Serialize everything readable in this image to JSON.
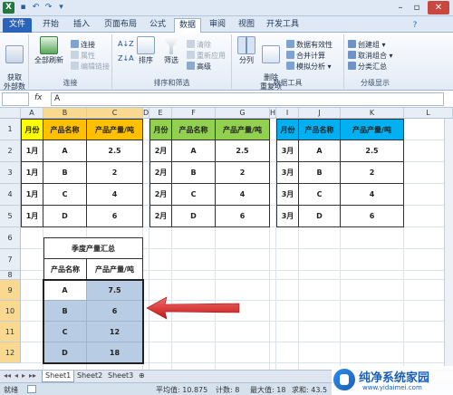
{
  "titlebar": {
    "app_icon": "X",
    "qa_icons": [
      "save-icon",
      "undo-icon",
      "redo-icon",
      "customize-icon"
    ]
  },
  "tabs": [
    "文件",
    "开始",
    "插入",
    "页面布局",
    "公式",
    "数据",
    "审阅",
    "视图",
    "开发工具"
  ],
  "active_tab": "数据",
  "ribbon": {
    "get_external": "获取\n外部数据",
    "refresh_all": "全部刷新",
    "connections": "连接",
    "properties": "属性",
    "edit_links": "编辑链接",
    "group_connect": "连接",
    "sort_az": "A↓Z",
    "sort_za": "Z↓A",
    "sort": "排序",
    "filter": "筛选",
    "clear": "清除",
    "reapply": "重新应用",
    "advanced": "高级",
    "group_sortfilter": "排序和筛选",
    "split": "分列",
    "remove_dup": "删除\n重复项",
    "data_valid": "数据有效性",
    "consolidate": "合并计算",
    "whatif": "模拟分析",
    "group_tools": "数据工具",
    "group_create": "创建组",
    "ungroup": "取消组合",
    "subtotal": "分类汇总",
    "group_outline": "分级显示"
  },
  "formula_bar": {
    "fx": "fx",
    "value": "A"
  },
  "columns": [
    "A",
    "B",
    "C",
    "D",
    "E",
    "F",
    "G",
    "H",
    "I",
    "J",
    "K",
    "L"
  ],
  "rows": [
    "1",
    "2",
    "3",
    "4",
    "5",
    "6",
    "7",
    "8",
    "9",
    "10",
    "11",
    "12"
  ],
  "tables": [
    {
      "month_header": "月份",
      "name_header": "产品名称",
      "prod_header": "产品产量/吨",
      "rows": [
        [
          "1月",
          "A",
          "2.5"
        ],
        [
          "1月",
          "B",
          "2"
        ],
        [
          "1月",
          "C",
          "4"
        ],
        [
          "1月",
          "D",
          "6"
        ]
      ]
    },
    {
      "month_header": "月份",
      "name_header": "产品名称",
      "prod_header": "产品产量/吨",
      "rows": [
        [
          "2月",
          "A",
          "2.5"
        ],
        [
          "2月",
          "B",
          "2"
        ],
        [
          "2月",
          "C",
          "4"
        ],
        [
          "2月",
          "D",
          "6"
        ]
      ]
    },
    {
      "month_header": "月份",
      "name_header": "产品名称",
      "prod_header": "产品产量/吨",
      "rows": [
        [
          "3月",
          "A",
          "2.5"
        ],
        [
          "3月",
          "B",
          "2"
        ],
        [
          "3月",
          "C",
          "4"
        ],
        [
          "3月",
          "D",
          "6"
        ]
      ]
    }
  ],
  "summary": {
    "title": "季度产量汇总",
    "name_header": "产品名称",
    "prod_header": "产品产量/吨",
    "rows": [
      [
        "A",
        "7.5"
      ],
      [
        "B",
        "6"
      ],
      [
        "C",
        "12"
      ],
      [
        "D",
        "18"
      ]
    ]
  },
  "sheets": [
    "Sheet1",
    "Sheet2",
    "Sheet3"
  ],
  "active_sheet": "Sheet1",
  "status": {
    "ready": "就绪",
    "average": "平均值: 10.875",
    "count": "计数: 8",
    "max": "最大值: 18",
    "sum": "求和: 43.5"
  },
  "watermark": {
    "title": "纯净系统家园",
    "url": "www.yidaimei.com"
  }
}
